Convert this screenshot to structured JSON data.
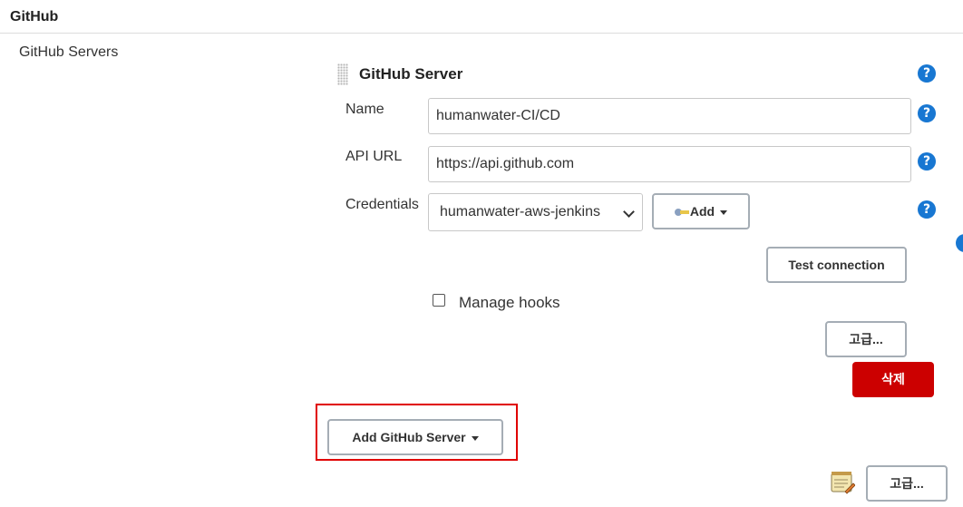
{
  "section": {
    "title": "GitHub"
  },
  "row": {
    "label": "GitHub Servers"
  },
  "server": {
    "title": "GitHub Server",
    "name_label": "Name",
    "name_value": "humanwater-CI/CD",
    "api_label": "API URL",
    "api_value": "https://api.github.com",
    "credentials_label": "Credentials",
    "credentials_value": "humanwater-aws-jenkins",
    "add_label": "Add",
    "test_connection": "Test connection",
    "manage_hooks_label": "Manage hooks",
    "manage_hooks_checked": false,
    "advanced_label": "고급...",
    "delete_label": "삭제"
  },
  "add_server_button": "Add GitHub Server",
  "bottom_advanced_label": "고급...",
  "help_glyph": "?",
  "icons": [
    "help-icon",
    "key-icon",
    "caret-down-icon",
    "notepad-icon",
    "drag-handle-icon"
  ],
  "colors": {
    "help": "#1877d2",
    "delete": "#cc0000",
    "highlight": "#e00000"
  }
}
